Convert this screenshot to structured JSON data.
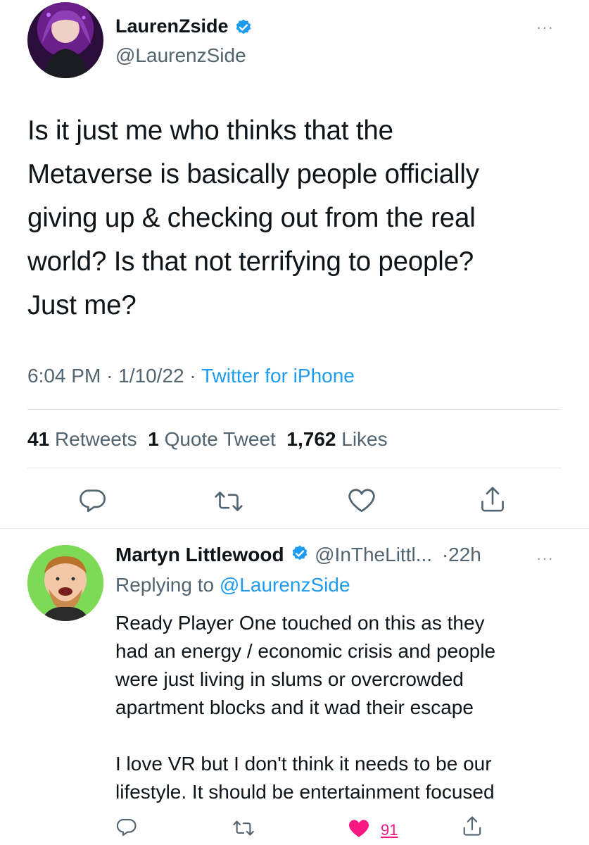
{
  "tweet": {
    "author_name": "LaurenZside",
    "author_handle": "@LaurenzSide",
    "text": "Is it just me who thinks that the\nMetaverse is basically people officially\ngiving up & checking out from the real\nworld? Is that not terrifying to people?\nJust me?",
    "time": "6:04 PM",
    "date": "1/10/22",
    "sep": "·",
    "source": "Twitter for iPhone",
    "stats": {
      "retweets_count": "41",
      "retweets_label": "Retweets",
      "quotes_count": "1",
      "quotes_label": "Quote Tweet",
      "likes_count": "1,762",
      "likes_label": "Likes"
    },
    "more_menu": "···"
  },
  "reply": {
    "author_name": "Martyn Littlewood",
    "author_handle": "@InTheLittl...",
    "age": "·22h",
    "replying_prefix": "Replying to",
    "replying_to": "@LaurenzSide",
    "text": "Ready Player One touched on this as they\nhad an energy / economic crisis and people\nwere just living in slums or overcrowded\napartment blocks and it wad their escape\n\nI love VR but I don't think it needs to be our\nlifestyle. It should be entertainment focused",
    "like_count": "91",
    "more_menu": "···"
  },
  "colors": {
    "accent": "#1d9bf0",
    "like": "#f91880",
    "muted": "#536471"
  }
}
